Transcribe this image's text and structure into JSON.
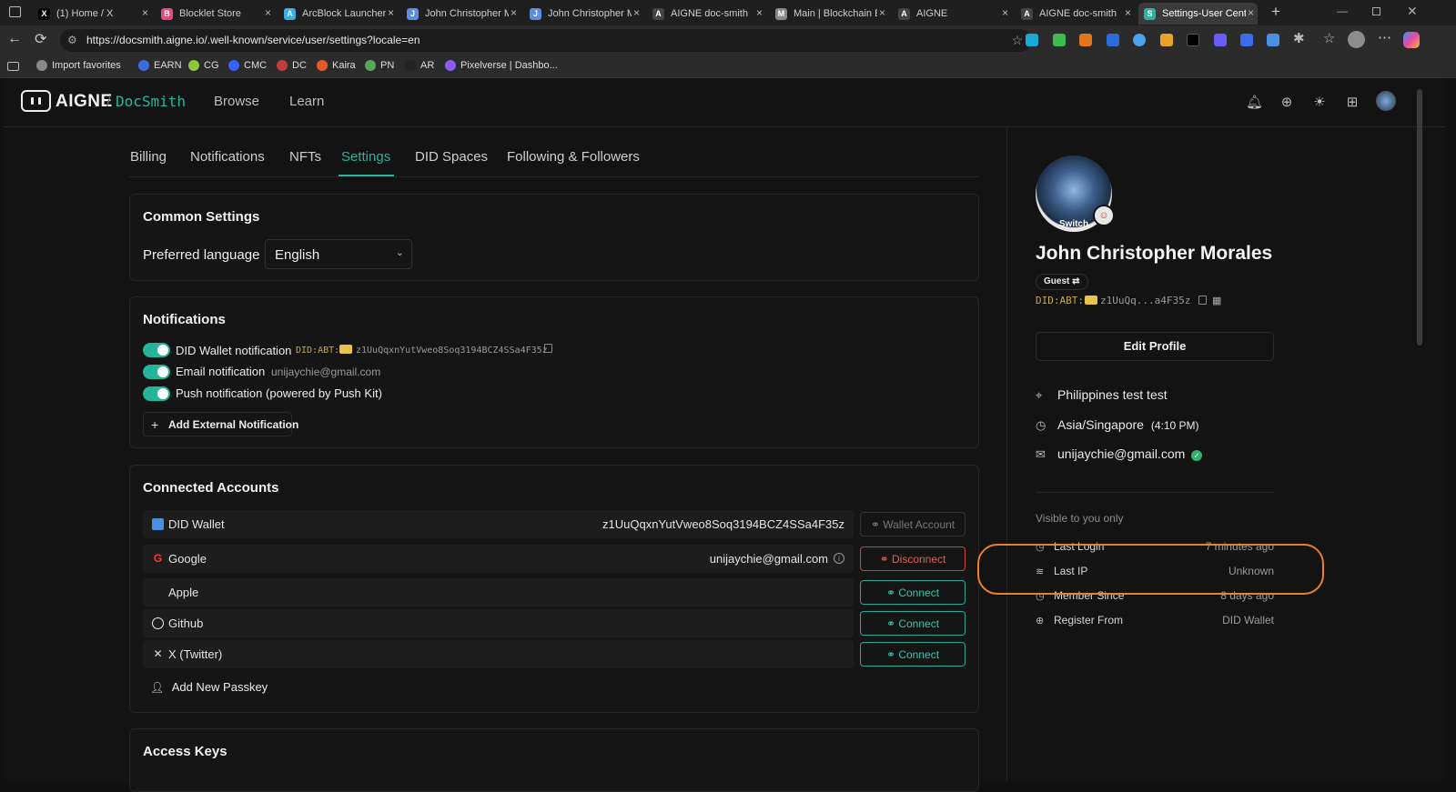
{
  "browser": {
    "tabs": [
      {
        "title": "(1) Home / X",
        "icon": "x-logo-icon",
        "color": "#000000",
        "glyph": "X"
      },
      {
        "title": "Blocklet Store",
        "icon": "blocklet-store-icon",
        "color": "#e84a7a",
        "glyph": "B"
      },
      {
        "title": "ArcBlock Launcher",
        "icon": "arcblock-launcher-icon",
        "color": "#3ab0e8",
        "glyph": "A"
      },
      {
        "title": "John Christopher M",
        "icon": "blue-page-icon",
        "color": "#5a8fe0",
        "glyph": "J"
      },
      {
        "title": "John Christopher M",
        "icon": "blue-page-icon",
        "color": "#5a8fe0",
        "glyph": "J"
      },
      {
        "title": "AIGNE doc-smith",
        "icon": "aigne-icon",
        "color": "#444444",
        "glyph": "A"
      },
      {
        "title": "Main | Blockchain E",
        "icon": "arcblock-icon",
        "color": "#888888",
        "glyph": "M"
      },
      {
        "title": "AIGNE",
        "icon": "aigne-icon",
        "color": "#444444",
        "glyph": "A"
      },
      {
        "title": "AIGNE doc-smith",
        "icon": "aigne-icon",
        "color": "#444444",
        "glyph": "A"
      },
      {
        "title": "Settings-User Cent",
        "icon": "settings-page-icon",
        "color": "#2bb39e",
        "glyph": "S",
        "active": true
      }
    ],
    "url": "https://docsmith.aigne.io/.well-known/service/user/settings?locale=en",
    "bookmarks": [
      {
        "label": "Import favorites",
        "color": "#888888"
      },
      {
        "label": "EARN",
        "color": "#3d6ee0"
      },
      {
        "label": "CG",
        "color": "#8dc63f"
      },
      {
        "label": "CMC",
        "color": "#3861fb"
      },
      {
        "label": "DC",
        "color": "#c33b3b"
      },
      {
        "label": "Kaira",
        "color": "#e35b2b"
      },
      {
        "label": "PN",
        "color": "#58a85b"
      },
      {
        "label": "AR",
        "color": "#222222"
      },
      {
        "label": "Pixelverse | Dashbo...",
        "color": "#8a5cf6"
      }
    ]
  },
  "app": {
    "brand": "AIGNE",
    "separator": "/",
    "product": "DocSmith",
    "nav": [
      "Browse",
      "Learn"
    ]
  },
  "tabs": [
    "Billing",
    "Notifications",
    "NFTs",
    "Settings",
    "DID Spaces",
    "Following & Followers"
  ],
  "active_tab": "Settings",
  "common": {
    "title": "Common Settings",
    "language_label": "Preferred language",
    "language_value": "English"
  },
  "notifications": {
    "title": "Notifications",
    "did_wallet_label": "DID Wallet notification",
    "did_prefix": "DID:ABT:",
    "did_value": "z1UuQqxnYutVweo8Soq3194BCZ4SSa4F35z",
    "email_label": "Email notification",
    "email_value": "unijaychie@gmail.com",
    "push_label": "Push notification (powered by Push Kit)",
    "add_external": "Add External Notification"
  },
  "connected": {
    "title": "Connected Accounts",
    "rows": [
      {
        "name": "DID Wallet",
        "value": "z1UuQqxnYutVweo8Soq3194BCZ4SSa4F35z",
        "action": "Wallet Account",
        "kind": "wallet"
      },
      {
        "name": "Google",
        "value": "unijaychie@gmail.com",
        "action": "Disconnect",
        "kind": "disconnect"
      },
      {
        "name": "Apple",
        "value": "",
        "action": "Connect",
        "kind": "connect"
      },
      {
        "name": "Github",
        "value": "",
        "action": "Connect",
        "kind": "connect"
      },
      {
        "name": "X (Twitter)",
        "value": "",
        "action": "Connect",
        "kind": "connect"
      }
    ],
    "add_passkey": "Add New Passkey"
  },
  "access_keys": {
    "title": "Access Keys"
  },
  "profile": {
    "switch_label": "Switch",
    "name": "John Christopher Morales",
    "role": "Guest",
    "did_prefix": "DID:ABT:",
    "did_short": "z1UuQq...a4F35z",
    "edit_profile": "Edit Profile",
    "location": "Philippines test test",
    "timezone": "Asia/Singapore",
    "local_time": "(4:10 PM)",
    "email": "unijaychie@gmail.com",
    "visible_label": "Visible to you only",
    "private_info": [
      {
        "label": "Last Login",
        "value": "7 minutes ago"
      },
      {
        "label": "Last IP",
        "value": "Unknown"
      },
      {
        "label": "Member Since",
        "value": "8 days ago"
      },
      {
        "label": "Register From",
        "value": "DID Wallet"
      }
    ]
  },
  "colors": {
    "accent": "#2bb39e",
    "danger": "#d0443f",
    "highlight": "#e8822a"
  }
}
